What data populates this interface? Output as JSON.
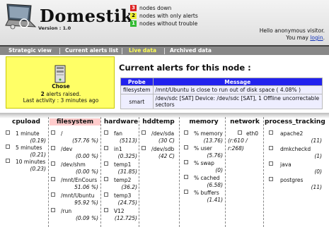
{
  "app": {
    "title": "Domestik",
    "version": "Version : 1.0"
  },
  "legend": [
    {
      "count": "3",
      "label": "nodes down",
      "color": "#dd2222"
    },
    {
      "count": "2",
      "label": "nodes with only alerts",
      "color": "#eeee33"
    },
    {
      "count": "1",
      "label": "nodes without trouble",
      "color": "#33bb33"
    }
  ],
  "user": {
    "greeting": "Hello anonymous visitor.",
    "prompt": "You may",
    "link": "login",
    "end": "."
  },
  "nav": [
    "Strategic view",
    "Current alerts list",
    "Live data",
    "Archived data"
  ],
  "node": {
    "name": "Chose",
    "alerts_count": "2",
    "alerts_text": "alerts raised.",
    "activity": "Last activity : 3 minutes ago"
  },
  "alerts": {
    "title": "Current alerts for this node :",
    "headers": [
      "Probe",
      "Message"
    ],
    "rows": [
      {
        "probe": "filesystem",
        "message": "/mnt/Ubuntu is close to run out of disk space ( 4.08% )"
      },
      {
        "probe": "smart",
        "message": "/dev/sdc [SAT] Device: /dev/sdc [SAT], 1 Offline uncorrectable sectors"
      }
    ]
  },
  "probes": [
    {
      "name": "cpuload",
      "items": [
        [
          "1 minute",
          "(0.19)"
        ],
        [
          "5 minutes",
          "(0.21)"
        ],
        [
          "10 minutes",
          "(0.23)"
        ]
      ]
    },
    {
      "name": "filesystem",
      "items": [
        [
          "/",
          "(57.76 %)"
        ],
        [
          "/dev",
          "(0.00 %)"
        ],
        [
          "/dev/shm",
          "(0.00 %)"
        ],
        [
          "/mnt/EnCours",
          "51.06 %)"
        ],
        [
          "/mnt/Ubuntu",
          "95.92 %)"
        ],
        [
          "/run",
          "(0.09 %)"
        ]
      ]
    },
    {
      "name": "hardware",
      "items": [
        [
          "fan",
          "(5113)"
        ],
        [
          "in1",
          "(0.325)"
        ],
        [
          "temp1",
          "(31.85)"
        ],
        [
          "temp2",
          "(36.2)"
        ],
        [
          "temp3",
          "(24.75)"
        ],
        [
          "V12",
          "(12.725)"
        ]
      ]
    },
    {
      "name": "hddtemp",
      "items": [
        [
          "/dev/sda",
          "(30 C)"
        ],
        [
          "/dev/sdb",
          "(42 C)"
        ]
      ]
    },
    {
      "name": "memory",
      "items": [
        [
          "% memory",
          "(13.76)"
        ],
        [
          "% user",
          "(5.76)"
        ],
        [
          "% swap",
          "(0)"
        ],
        [
          "% cached",
          "(6.58)"
        ],
        [
          "% buffers",
          "(1.41)"
        ]
      ]
    },
    {
      "name": "network",
      "items": [
        [
          "eth0",
          "(r:610 / r:268)"
        ]
      ]
    },
    {
      "name": "process_tracking",
      "items": [
        [
          "apache2",
          "(11)"
        ],
        [
          "dmkcheckd",
          "(1)"
        ],
        [
          "java",
          "(0)"
        ],
        [
          "postgres",
          "(11)"
        ]
      ]
    }
  ]
}
